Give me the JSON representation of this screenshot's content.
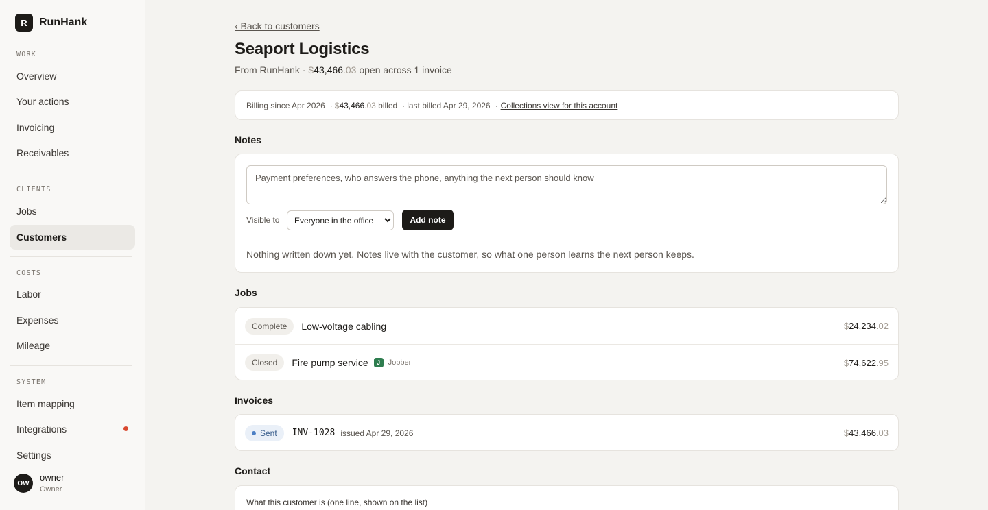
{
  "app": {
    "logo_letter": "R",
    "name": "RunHank"
  },
  "sidebar": {
    "sections": [
      {
        "label": "WORK",
        "items": [
          "Overview",
          "Your actions",
          "Invoicing",
          "Receivables"
        ]
      },
      {
        "label": "CLIENTS",
        "items": [
          "Jobs",
          "Customers"
        ]
      },
      {
        "label": "COSTS",
        "items": [
          "Labor",
          "Expenses",
          "Mileage"
        ]
      },
      {
        "label": "SYSTEM",
        "items": [
          "Item mapping",
          "Integrations",
          "Settings"
        ]
      }
    ],
    "active_item": "Customers"
  },
  "user": {
    "initials": "OW",
    "name": "owner",
    "role": "Owner"
  },
  "page": {
    "back_link": "‹ Back to customers",
    "title": "Seaport Logistics",
    "subtitle": {
      "prefix": "From RunHank · ",
      "dollar": "$",
      "amount_main": "43,466",
      "amount_cents": ".03",
      "suffix": " open across 1 invoice"
    }
  },
  "billing": {
    "since": "Billing since Apr 2026",
    "sep": "·",
    "dollar": "$",
    "billed_main": "43,466",
    "billed_cents": ".03",
    "billed_suffix": " billed",
    "last_billed": "last billed Apr 29, 2026",
    "collections_link": "Collections view for this account"
  },
  "notes": {
    "heading": "Notes",
    "placeholder": "Payment preferences, who answers the phone, anything the next person should know",
    "visible_label": "Visible to",
    "visible_selected": "Everyone in the office",
    "add_button": "Add note",
    "empty_text": "Nothing written down yet. Notes live with the customer, so what one person learns the next person keeps."
  },
  "jobs": {
    "heading": "Jobs",
    "rows": [
      {
        "status": "Complete",
        "title": "Low-voltage cabling",
        "source_badge": "",
        "source_name": "",
        "dollar": "$",
        "amount_main": "24,234",
        "amount_cents": ".02"
      },
      {
        "status": "Closed",
        "title": "Fire pump service",
        "source_badge": "J",
        "source_name": "Jobber",
        "dollar": "$",
        "amount_main": "74,622",
        "amount_cents": ".95"
      }
    ]
  },
  "invoices": {
    "heading": "Invoices",
    "rows": [
      {
        "status": "Sent",
        "number": "INV-1028",
        "issued": "issued Apr 29, 2026",
        "dollar": "$",
        "amount_main": "43,466",
        "amount_cents": ".03"
      }
    ]
  },
  "contact": {
    "heading": "Contact",
    "first_field_label": "What this customer is (one line, shown on the list)"
  },
  "colors": {
    "accent_dark": "#1d1b18",
    "notification_dot": "#d9482f",
    "jobber_green": "#2e7d4f",
    "sent_blue": "#4c7fc4"
  },
  "icons": {
    "notification": "notification-dot-icon",
    "select": "chevron-down-icon",
    "status_sent": "status-dot-icon"
  }
}
